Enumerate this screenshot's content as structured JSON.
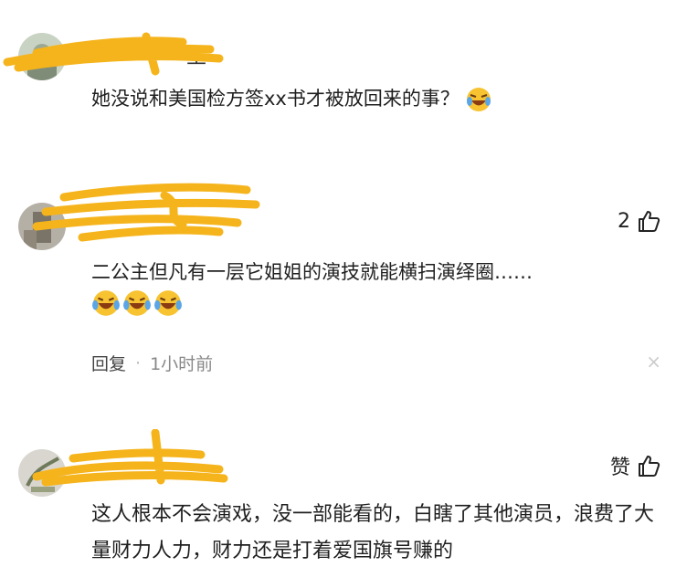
{
  "comments": [
    {
      "name_fragment": "生",
      "text": "她没说和美国检方签xx书才被放回来的事？",
      "emoji": "laughing-crying-emoji"
    },
    {
      "name_fragment": "",
      "text": "二公主但凡有一层它姐姐的演技就能横扫演绎圈……",
      "likes": "2",
      "emoji_count": 3,
      "reply_label": "回复",
      "separator": "·",
      "time": "1小时前",
      "close": "×"
    },
    {
      "name_fragment": "",
      "text": "这人根本不会演戏，没一部能看的，白瞎了其他演员，浪费了大量财力人力，财力还是打着爱国旗号赚的",
      "likes": "赞"
    }
  ],
  "colors": {
    "scribble": "#f5b41c",
    "emoji_face": "#f7c331"
  }
}
